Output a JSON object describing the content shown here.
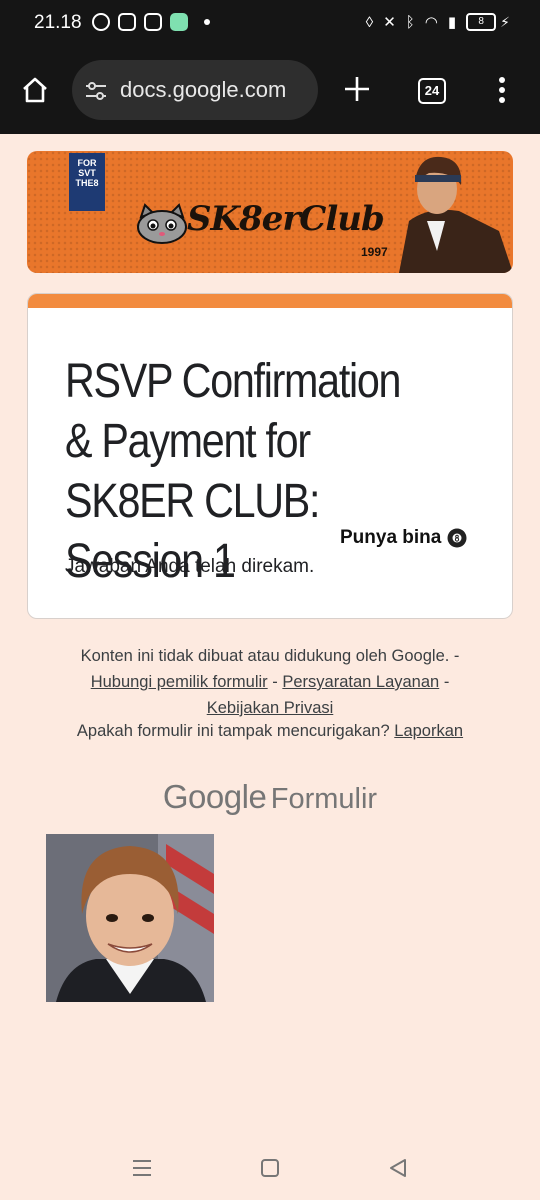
{
  "status_bar": {
    "time": "21.18",
    "notification_icons": [
      "whatsapp-icon",
      "instagram-icon",
      "shopping-icon",
      "app-icon"
    ],
    "battery": "8"
  },
  "browser": {
    "url": "docs.google.com",
    "tab_count": "24"
  },
  "banner": {
    "flag_text": "FOR SVT THE8",
    "logo_text": "SK8erClub",
    "year": "1997"
  },
  "form": {
    "title": "RSVP Confirmation & Payment for SK8ER CLUB: Session 1",
    "response_message": "Jawaban Anda telah direkam."
  },
  "overlay_text": "Punya bina",
  "footer": {
    "disclaimer": "Konten ini tidak dibuat atau didukung oleh Google. -",
    "contact_owner": "Hubungi pemilik formulir",
    "separator": "-",
    "terms": "Persyaratan Layanan",
    "separator2": "-",
    "privacy": "Kebijakan Privasi",
    "suspicious_question": "Apakah formulir ini tampak mencurigakan?",
    "report_link": "Laporkan"
  },
  "branding": {
    "google": "Google",
    "product": "Formulir"
  },
  "colors": {
    "page_background": "#fdeae0",
    "accent": "#f28b3f",
    "banner": "#e9762b",
    "system_bar": "#151515"
  }
}
